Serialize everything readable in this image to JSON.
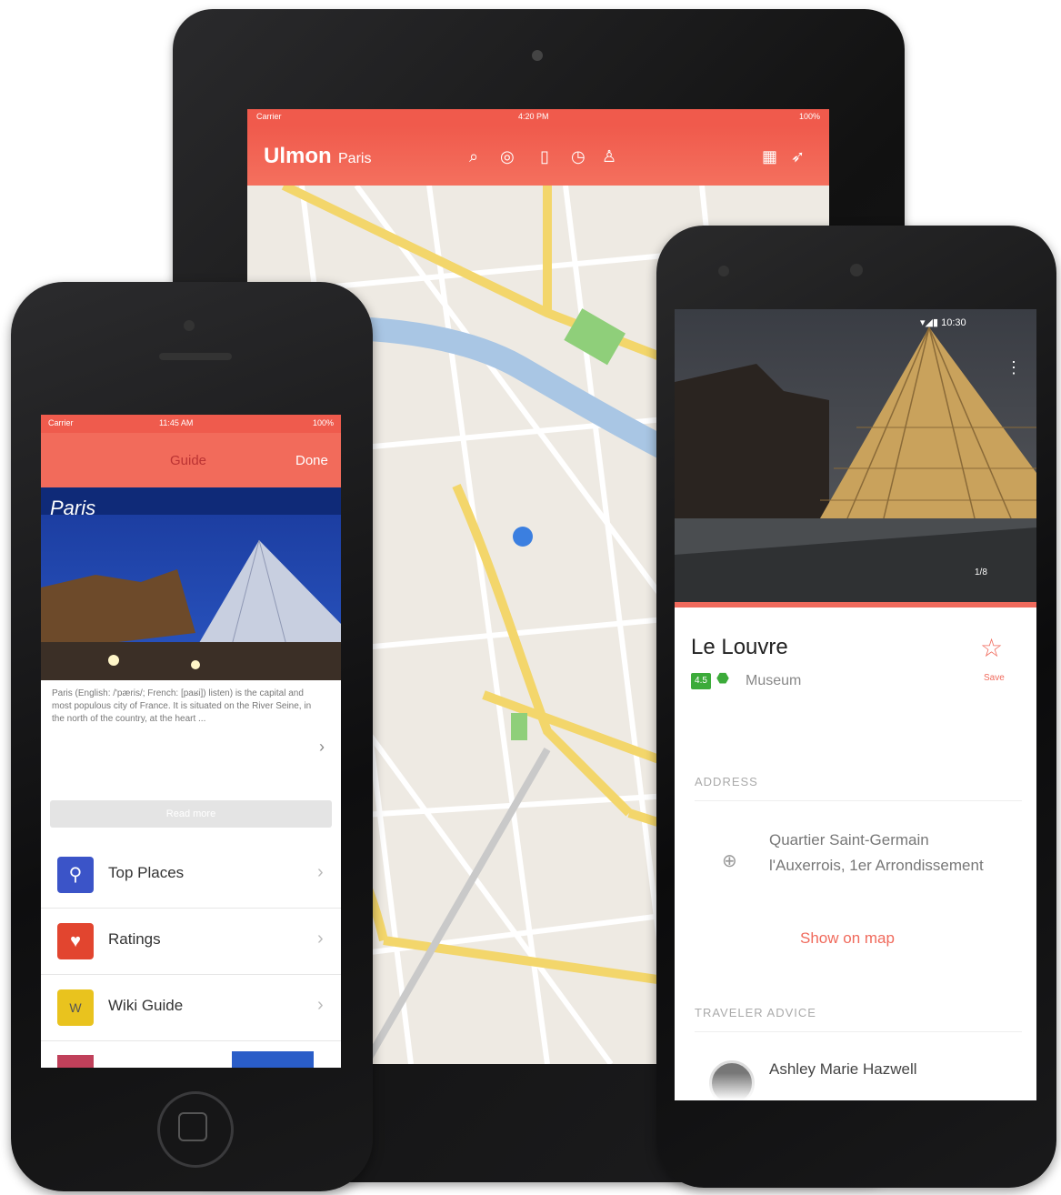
{
  "tablet": {
    "status_left": "Carrier",
    "status_center": "4:20 PM",
    "status_right": "100%",
    "logo": "Ulmon",
    "city": "Paris",
    "icons": [
      "search-icon",
      "compass-icon",
      "book-icon",
      "clock-icon",
      "person-icon",
      "grid-icon",
      "location-arrow-icon"
    ]
  },
  "iphone": {
    "status_left": "Carrier",
    "status_center": "11:45 AM",
    "status_right": "100%",
    "nav_title": "Guide",
    "nav_done": "Done",
    "city": "Paris",
    "description": "Paris (English: /'pæris/; French: [paʁi]) listen) is the capital and most populous city of France. It is situated on the River Seine, in the north of the country, at the heart ...",
    "read_more": "Read more",
    "rows": [
      {
        "label": "Top Places",
        "icon": "pin-icon",
        "color": "#3b54c8",
        "glyph": "⚲"
      },
      {
        "label": "Ratings",
        "icon": "heart-icon",
        "color": "#e2452f",
        "glyph": "♥"
      },
      {
        "label": "Wiki Guide",
        "icon": "wikivoyage-icon",
        "color": "#e9c31e",
        "glyph": "W"
      }
    ]
  },
  "android": {
    "status": "▾◢▮ 10:30",
    "photo_count": "1/8",
    "title": "Le Louvre",
    "badge": "4.5",
    "category": "Museum",
    "save_label": "Save",
    "address_heading": "ADDRESS",
    "address": "Quartier Saint-Germain l'Auxerrois, 1er Arrondissement",
    "show_on_map": "Show on map",
    "advice_heading": "TRAVELER ADVICE",
    "author": "Ashley Marie Hazwell"
  },
  "colors": {
    "brand_red": "#f05a4c",
    "accent_coral": "#f06a5c",
    "map_road_yellow": "#f3d66b",
    "map_river": "#a9c6e4",
    "location_dot": "#3b7fe0"
  }
}
